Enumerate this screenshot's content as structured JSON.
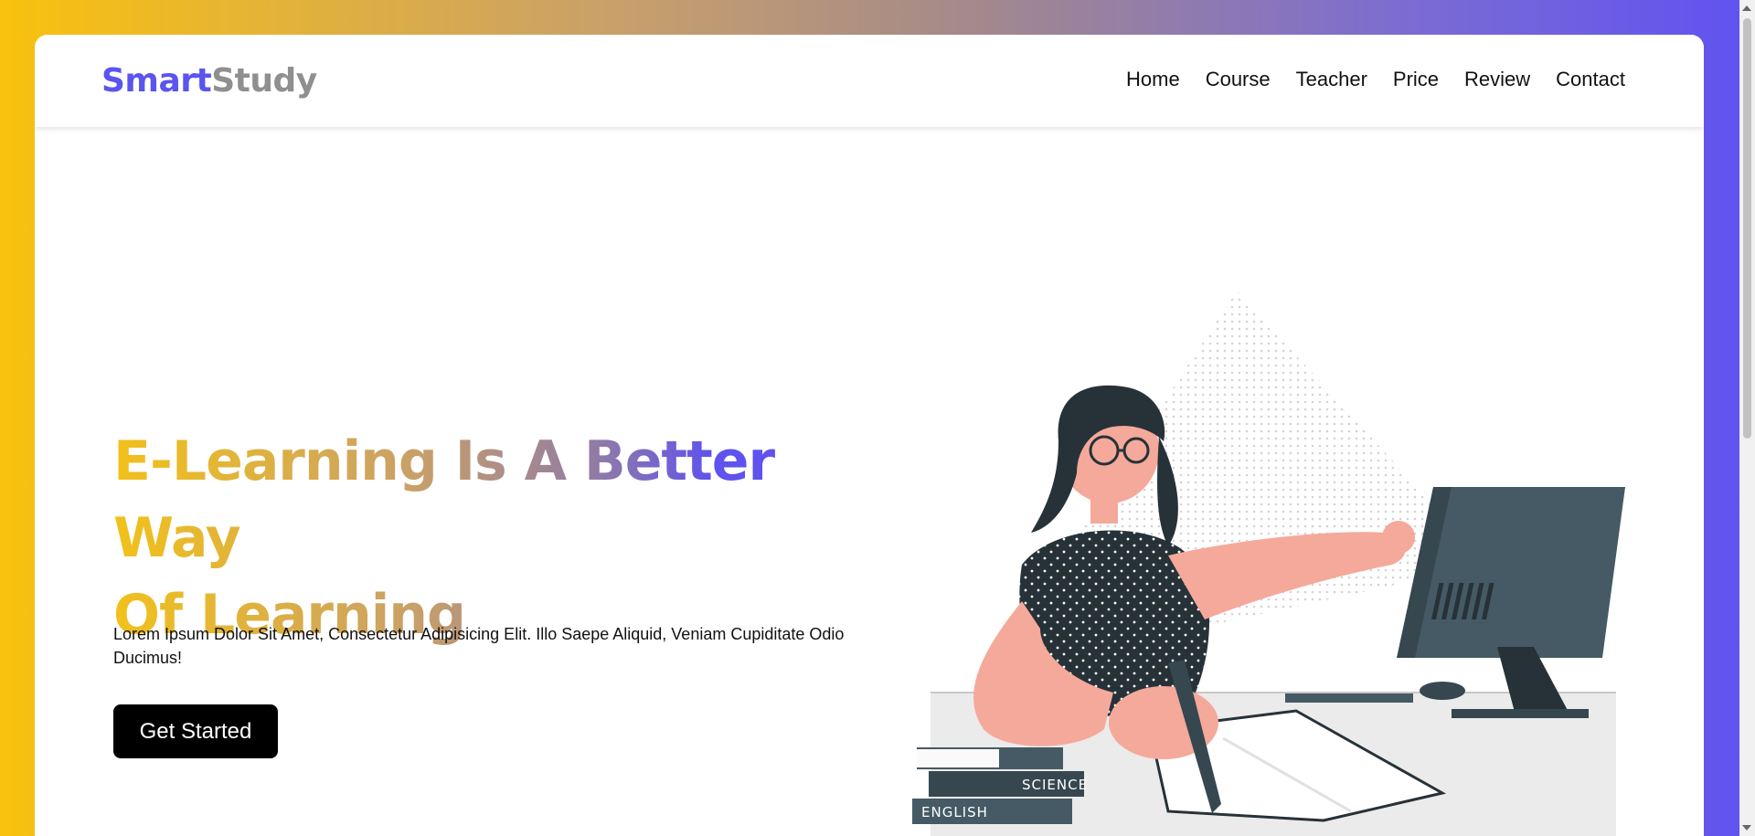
{
  "brand": {
    "part1": "Smart",
    "part2": "Study"
  },
  "nav": {
    "items": [
      {
        "label": "Home"
      },
      {
        "label": "Course"
      },
      {
        "label": "Teacher"
      },
      {
        "label": "Price"
      },
      {
        "label": "Review"
      },
      {
        "label": "Contact"
      }
    ]
  },
  "hero": {
    "title_line1": "E-Learning Is A Better Way",
    "title_line2": "Of Learning",
    "text": "Lorem Ipsum Dolor Sit Amet, Consectetur Adipisicing Elit. Illo Saepe Aliquid, Veniam Cupiditate Odio Ducimus!",
    "cta_label": "Get Started"
  },
  "illustration": {
    "book_labels": [
      "SCIENCE",
      "ENGLISH"
    ]
  },
  "colors": {
    "brand_primary": "#5b54ee",
    "brand_secondary": "#8f8f8f",
    "gradient_start": "#f9c20e",
    "gradient_end": "#5f52f2",
    "button_bg": "#000000"
  }
}
